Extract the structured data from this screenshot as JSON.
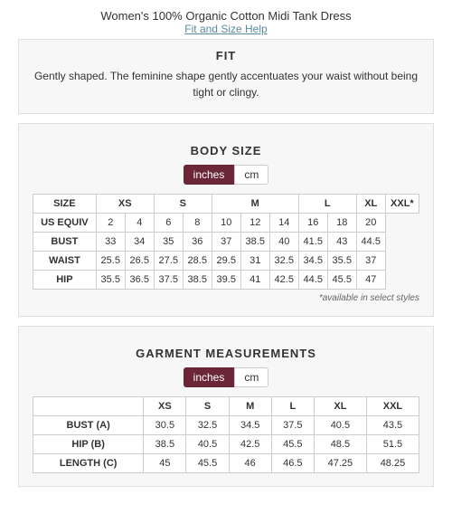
{
  "header": {
    "title": "Women's 100% Organic Cotton Midi Tank Dress",
    "help_text": "Fit and Size Help"
  },
  "fit_section": {
    "label": "FIT",
    "description_plain": "Gently shaped. ",
    "description_highlight": "The feminine shape gently accentuates your waist without being tight or clingy."
  },
  "body_size": {
    "title": "BODY SIZE",
    "toggle": {
      "inches_label": "inches",
      "cm_label": "cm",
      "active": "inches"
    },
    "table": {
      "headers": [
        "SIZE",
        "XS",
        "S",
        "",
        "M",
        "",
        "",
        "L",
        "",
        "XL",
        "XXL*"
      ],
      "rows": [
        {
          "label": "SIZE",
          "values": [
            "XS",
            "S",
            "",
            "M",
            "",
            "",
            "L",
            "",
            "XL",
            "XXL*"
          ]
        },
        {
          "label": "US EQUIV",
          "values": [
            "2",
            "4",
            "6",
            "8",
            "10",
            "12",
            "14",
            "16",
            "18",
            "20"
          ]
        },
        {
          "label": "BUST",
          "values": [
            "33",
            "34",
            "35",
            "36",
            "37",
            "38.5",
            "40",
            "41.5",
            "43",
            "44.5"
          ]
        },
        {
          "label": "WAIST",
          "values": [
            "25.5",
            "26.5",
            "27.5",
            "28.5",
            "29.5",
            "31",
            "32.5",
            "34.5",
            "35.5",
            "37"
          ]
        },
        {
          "label": "HIP",
          "values": [
            "35.5",
            "36.5",
            "37.5",
            "38.5",
            "39.5",
            "41",
            "42.5",
            "44.5",
            "45.5",
            "47"
          ]
        }
      ],
      "header_row": [
        "SIZE",
        "XS",
        "S",
        "M",
        "L",
        "XL",
        "XXL*"
      ],
      "us_equiv": [
        "US EQUIV",
        "2",
        "4",
        "6",
        "8",
        "10",
        "12",
        "14",
        "16",
        "18",
        "20"
      ],
      "bust": [
        "BUST",
        "33",
        "34",
        "35",
        "36",
        "37",
        "38.5",
        "40",
        "41.5",
        "43",
        "44.5"
      ],
      "waist": [
        "WAIST",
        "25.5",
        "26.5",
        "27.5",
        "28.5",
        "29.5",
        "31",
        "32.5",
        "34.5",
        "35.5",
        "37"
      ],
      "hip": [
        "HIP",
        "35.5",
        "36.5",
        "37.5",
        "38.5",
        "39.5",
        "41",
        "42.5",
        "44.5",
        "45.5",
        "47"
      ]
    },
    "footnote": "*available in select styles"
  },
  "garment_measurements": {
    "title": "GARMENT MEASUREMENTS",
    "toggle": {
      "inches_label": "inches",
      "cm_label": "cm",
      "active": "inches"
    },
    "table": {
      "header_row": [
        "",
        "XS",
        "S",
        "M",
        "L",
        "XL",
        "XXL"
      ],
      "bust_a": [
        "BUST (A)",
        "30.5",
        "32.5",
        "34.5",
        "37.5",
        "40.5",
        "43.5"
      ],
      "hip_b": [
        "HIP (B)",
        "38.5",
        "40.5",
        "42.5",
        "45.5",
        "48.5",
        "51.5"
      ],
      "length_c": [
        "LENGTH (C)",
        "45",
        "45.5",
        "46",
        "46.5",
        "47.25",
        "48.25"
      ]
    }
  }
}
